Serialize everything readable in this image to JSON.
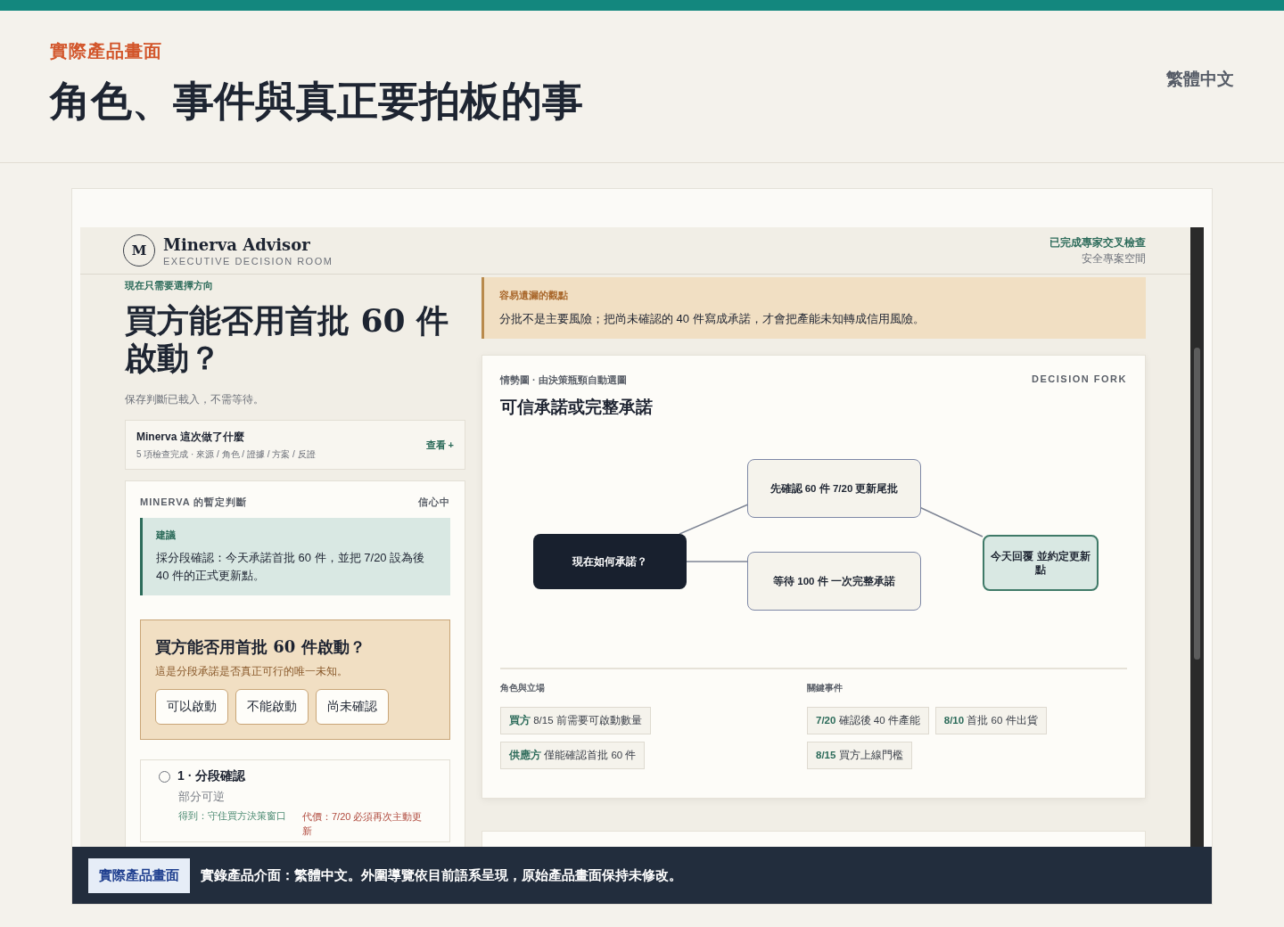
{
  "page": {
    "eyebrow": "實際產品畫面",
    "title": "角色、事件與真正要拍板的事",
    "language": "繁體中文"
  },
  "app": {
    "brand": {
      "initial": "M",
      "name": "Minerva Advisor",
      "tagline": "EXECUTIVE DECISION ROOM"
    },
    "status": {
      "check": "已完成專家交叉檢查",
      "space": "安全專案空間"
    },
    "left": {
      "eyebrow": "現在只需要選擇方向",
      "question": "買方能否用首批 60 件啟動？",
      "note": "保存判斷已載入，不需等待。",
      "summary": {
        "title": "Minerva 這次做了什麼",
        "detail": "5 項檢查完成 · 來源 / 角色 / 證據 / 方案 / 反證",
        "action": "查看 +"
      },
      "judgement": {
        "label": "MINERVA 的暫定判斷",
        "confidence": "信心中",
        "recommendation": {
          "label": "建議",
          "text": "採分段確認：今天承諾首批 60 件，並把 7/20 設為後 40 件的正式更新點。"
        },
        "unknown": {
          "question": "買方能否用首批 60 件啟動？",
          "note": "這是分段承諾是否真正可行的唯一未知。",
          "answers": [
            "可以啟動",
            "不能啟動",
            "尚未確認"
          ]
        },
        "options": [
          {
            "title": "1 · 分段確認",
            "selected": false,
            "reversibility": "部分可逆",
            "gain": "得到：守住買方決策窗口",
            "cost": "代價：7/20 必須再次主動更新"
          }
        ]
      }
    },
    "right": {
      "insight": {
        "label": "容易遺漏的觀點",
        "text": "分批不是主要風險；把尚未確認的 40 件寫成承諾，才會把產能未知轉成信用風險。"
      },
      "situation": {
        "eyebrow": "情勢圖 · 由決策瓶頸自動選圖",
        "tag": "DECISION FORK",
        "title": "可信承諾或完整承諾",
        "nodes": [
          {
            "kind": "question",
            "label": "現在如何承諾？"
          },
          {
            "kind": "option",
            "label": "先確認 60 件 7/20 更新尾批"
          },
          {
            "kind": "option",
            "label": "等待 100 件 一次完整承諾"
          },
          {
            "kind": "outcome",
            "label": "今天回覆 並約定更新點"
          }
        ],
        "roles": {
          "label": "角色與立場",
          "items": [
            {
              "who": "買方",
              "text": "8/15 前需要可啟動數量"
            },
            {
              "who": "供應方",
              "text": "僅能確認首批 60 件"
            }
          ]
        },
        "events": {
          "label": "關鍵事件",
          "items": [
            {
              "date": "7/20",
              "text": "確認後 40 件產能"
            },
            {
              "date": "8/10",
              "text": "首批 60 件出貨"
            },
            {
              "date": "8/15",
              "text": "買方上線門檻"
            }
          ]
        }
      }
    }
  },
  "caption": {
    "badge": "實際產品畫面",
    "text": "實錄產品介面：繁體中文。外圍導覽依目前語系呈現，原始產品畫面保持未修改。"
  }
}
